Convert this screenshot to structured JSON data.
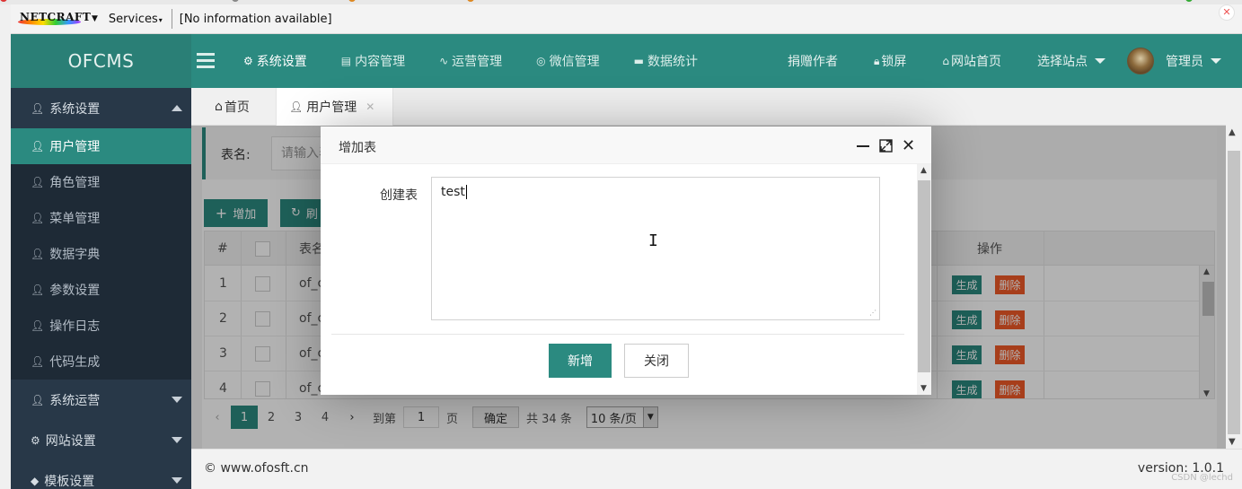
{
  "browser": {
    "netcraft_label": "NETCRAFT",
    "services_label": "Services",
    "info_text": "[No information available]"
  },
  "header": {
    "logo": "OFCMS",
    "nav": [
      {
        "icon": "gear-icon",
        "label": "系统设置"
      },
      {
        "icon": "document-icon",
        "label": "内容管理"
      },
      {
        "icon": "pulse-icon",
        "label": "运营管理"
      },
      {
        "icon": "wechat-icon",
        "label": "微信管理"
      },
      {
        "icon": "chat-icon",
        "label": "数据统计"
      }
    ],
    "right": {
      "donate": "捐赠作者",
      "lock": "锁屏",
      "home": "网站首页",
      "site_select": "选择站点",
      "admin": "管理员"
    }
  },
  "sidebar": {
    "section_system": "系统设置",
    "items": [
      "用户管理",
      "角色管理",
      "菜单管理",
      "数据字典",
      "参数设置",
      "操作日志",
      "代码生成"
    ],
    "section_ops": "系统运营",
    "section_site": "网站设置",
    "section_tpl": "模板设置"
  },
  "tabs": {
    "home": "首页",
    "user": "用户管理"
  },
  "search": {
    "label": "表名:",
    "placeholder": "请输入表"
  },
  "toolbar": {
    "add": "增加",
    "refresh": "刷"
  },
  "table": {
    "headers": {
      "index": "#",
      "name": "表名",
      "ops": "操作"
    },
    "rows": [
      {
        "index": "1",
        "name": "of_c"
      },
      {
        "index": "2",
        "name": "of_c"
      },
      {
        "index": "3",
        "name": "of_c"
      },
      {
        "index": "4",
        "name": "of_c"
      }
    ],
    "gen_label": "生成",
    "del_label": "删除"
  },
  "pager": {
    "pages": [
      "1",
      "2",
      "3",
      "4"
    ],
    "goto_label": "到第",
    "page_value": "1",
    "page_unit": "页",
    "confirm": "确定",
    "total": "共 34 条",
    "per_page": "10 条/页"
  },
  "footer": {
    "copyright": "© www.ofosft.cn",
    "version": "version:  1.0.1",
    "watermark": "CSDN @lechd"
  },
  "modal": {
    "title": "增加表",
    "field_label": "创建表",
    "field_value": "test",
    "ok": "新增",
    "cancel": "关闭"
  }
}
